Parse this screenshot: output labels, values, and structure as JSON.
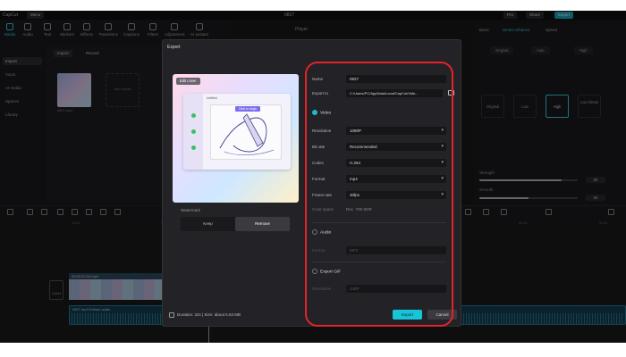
{
  "app": {
    "title": "0827",
    "menu": "Menu",
    "logo": "CapCut",
    "share_label": "Share",
    "pro_label": "Pro",
    "export_label": "Export"
  },
  "toolbar": {
    "tools": [
      "Media",
      "Audio",
      "Text",
      "Stickers",
      "Effects",
      "Transitions",
      "Captions",
      "Filters",
      "Adjustment",
      "AI avatars"
    ]
  },
  "left_nav": {
    "items": [
      "Import",
      "Yours",
      "AI media",
      "Spaces",
      "Library"
    ]
  },
  "media": {
    "import_label": "Import",
    "record_label": "Record",
    "thumb_label": "0827.mp4",
    "add_label": "Add media"
  },
  "player": {
    "title": "Player"
  },
  "right_panel": {
    "tabs": [
      "Basic",
      "Smart enhance",
      "Speed"
    ],
    "sub_tabs": [
      "Original",
      "Auto",
      "High",
      "Low bitrate"
    ],
    "qualities": [
      "Original",
      "Low",
      "High",
      "Low bitrate"
    ],
    "selected_quality": "High",
    "slider1_label": "Strength",
    "slider1_value": "50",
    "slider1_level": 0.84,
    "slider2_label": "Smooth",
    "slider2_value": "50",
    "slider2_level": 0.5
  },
  "timeline": {
    "ruler": [
      "00:00",
      "00:05",
      "00:10",
      "00:15",
      "00:20",
      "00:25",
      "00:30"
    ],
    "cover_label": "Cover",
    "clip1_label": "00:00:22:00.mp4",
    "clip2_label": "0827.mp4   Extract audio"
  },
  "export_dialog": {
    "title": "Export",
    "edit_cover": "Edit cover",
    "mock_window_title": "Untitled",
    "mock_caption": "Click to begin",
    "background_label": "Watermark",
    "background_options": [
      "Keep",
      "Remove"
    ],
    "background_selected": "Remove",
    "duration_text": "Duration: 22s | Size: about 5.53 MB",
    "name_label": "Name",
    "name_value": "0827",
    "export_to_label": "Export to",
    "export_to_value": "C:/Users/PC/AppData/Local/CapCut/Vide...",
    "video_section": "Video",
    "resolution_label": "Resolution",
    "resolution_value": "1080P",
    "bitrate_label": "Bit rate",
    "bitrate_value": "Recommended",
    "codec_label": "Codec",
    "codec_value": "H.264",
    "format_label": "Format",
    "format_value": "mp4",
    "framerate_label": "Frame rate",
    "framerate_value": "30fps",
    "color_space_label": "Color space",
    "color_space_value": "Rec. 709 SDR",
    "audio_section": "Audio",
    "audio_format_label": "Format",
    "audio_format_value": "MP3",
    "gif_section": "Export GIF",
    "gif_resolution_label": "Resolution",
    "gif_resolution_value": "240P",
    "export_button": "Export",
    "cancel_button": "Cancel"
  },
  "colors": {
    "accent": "#18c4d8",
    "highlight": "#e3232a",
    "background": "#18181b"
  }
}
